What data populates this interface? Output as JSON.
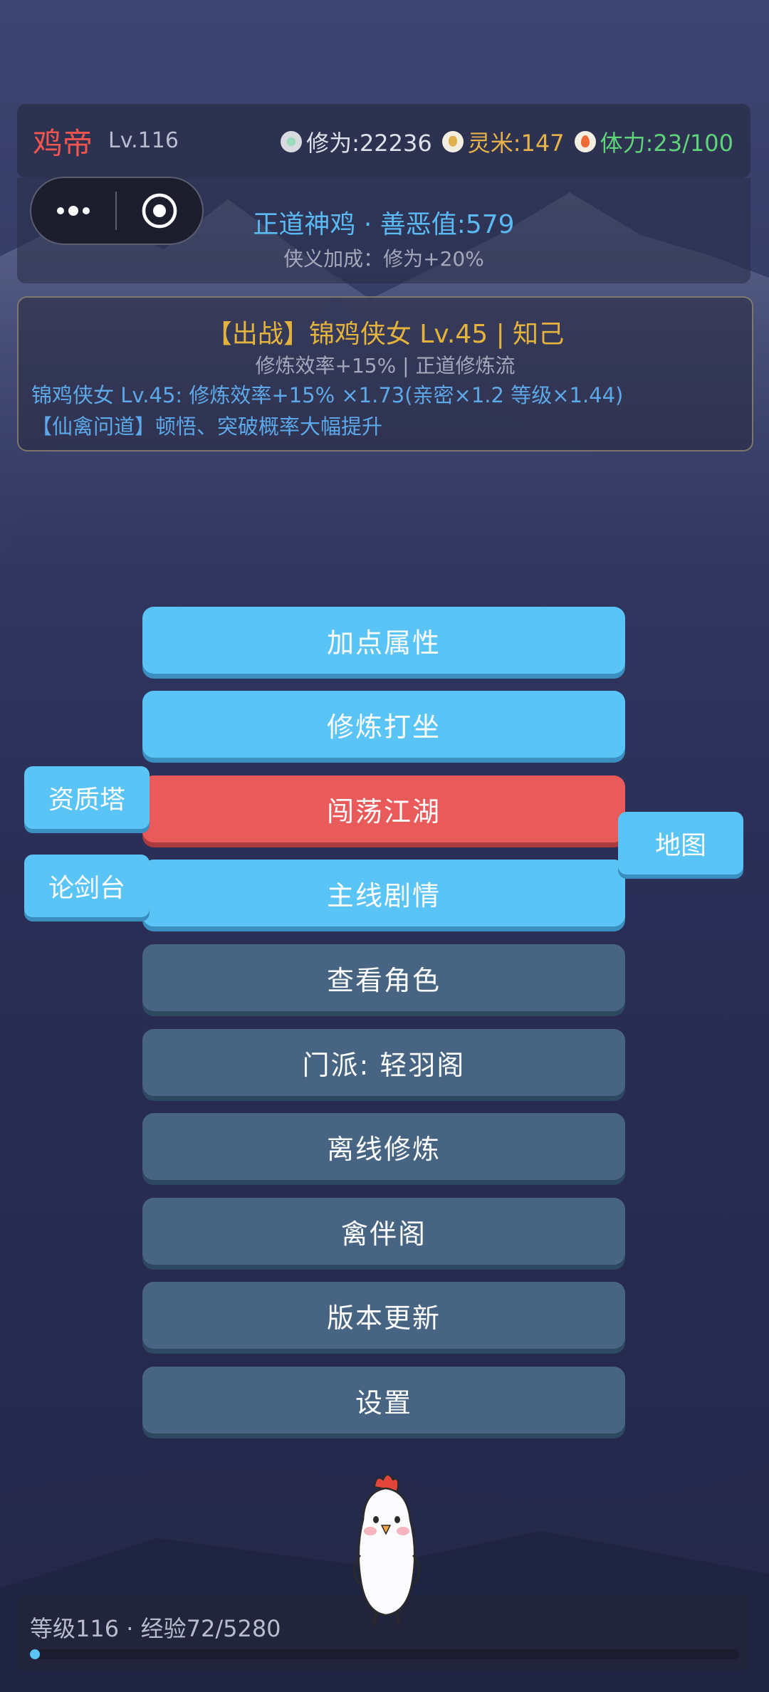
{
  "player": {
    "name": "鸡帝",
    "level": "Lv.116"
  },
  "stats": {
    "cultivation": "修为:22236",
    "rice": "灵米:147",
    "stamina": "体力:23/100"
  },
  "alignment": {
    "text": "正道神鸡 · 善恶值:579",
    "bonus": "侠义加成：修为+20%"
  },
  "companion": {
    "title": "【出战】锦鸡侠女 Lv.45 | 知己",
    "subtitle": "修炼效率+15% | 正道修炼流",
    "detail": "锦鸡侠女 Lv.45: 修炼效率+15% ×1.73(亲密×1.2 等级×1.44)",
    "skill": "【仙禽问道】顿悟、突破概率大幅提升"
  },
  "menu": [
    {
      "label": "加点属性",
      "style": "blue"
    },
    {
      "label": "修炼打坐",
      "style": "blue"
    },
    {
      "label": "闯荡江湖",
      "style": "red"
    },
    {
      "label": "主线剧情",
      "style": "blue"
    },
    {
      "label": "查看角色",
      "style": "slate"
    },
    {
      "label": "门派: 轻羽阁",
      "style": "slate"
    },
    {
      "label": "离线修炼",
      "style": "slate"
    },
    {
      "label": "禽伴阁",
      "style": "slate"
    },
    {
      "label": "版本更新",
      "style": "slate"
    },
    {
      "label": "设置",
      "style": "slate"
    }
  ],
  "side": {
    "tower": "资质塔",
    "arena": "论剑台",
    "map": "地图"
  },
  "exp": {
    "text": "等级116 · 经验72/5280",
    "progress": 0.0136
  },
  "colors": {
    "accent_blue": "#5bc4f6",
    "danger_red": "#e95a5b",
    "slate": "#476583",
    "gold": "#e3b33d",
    "name_red": "#f0554f"
  }
}
